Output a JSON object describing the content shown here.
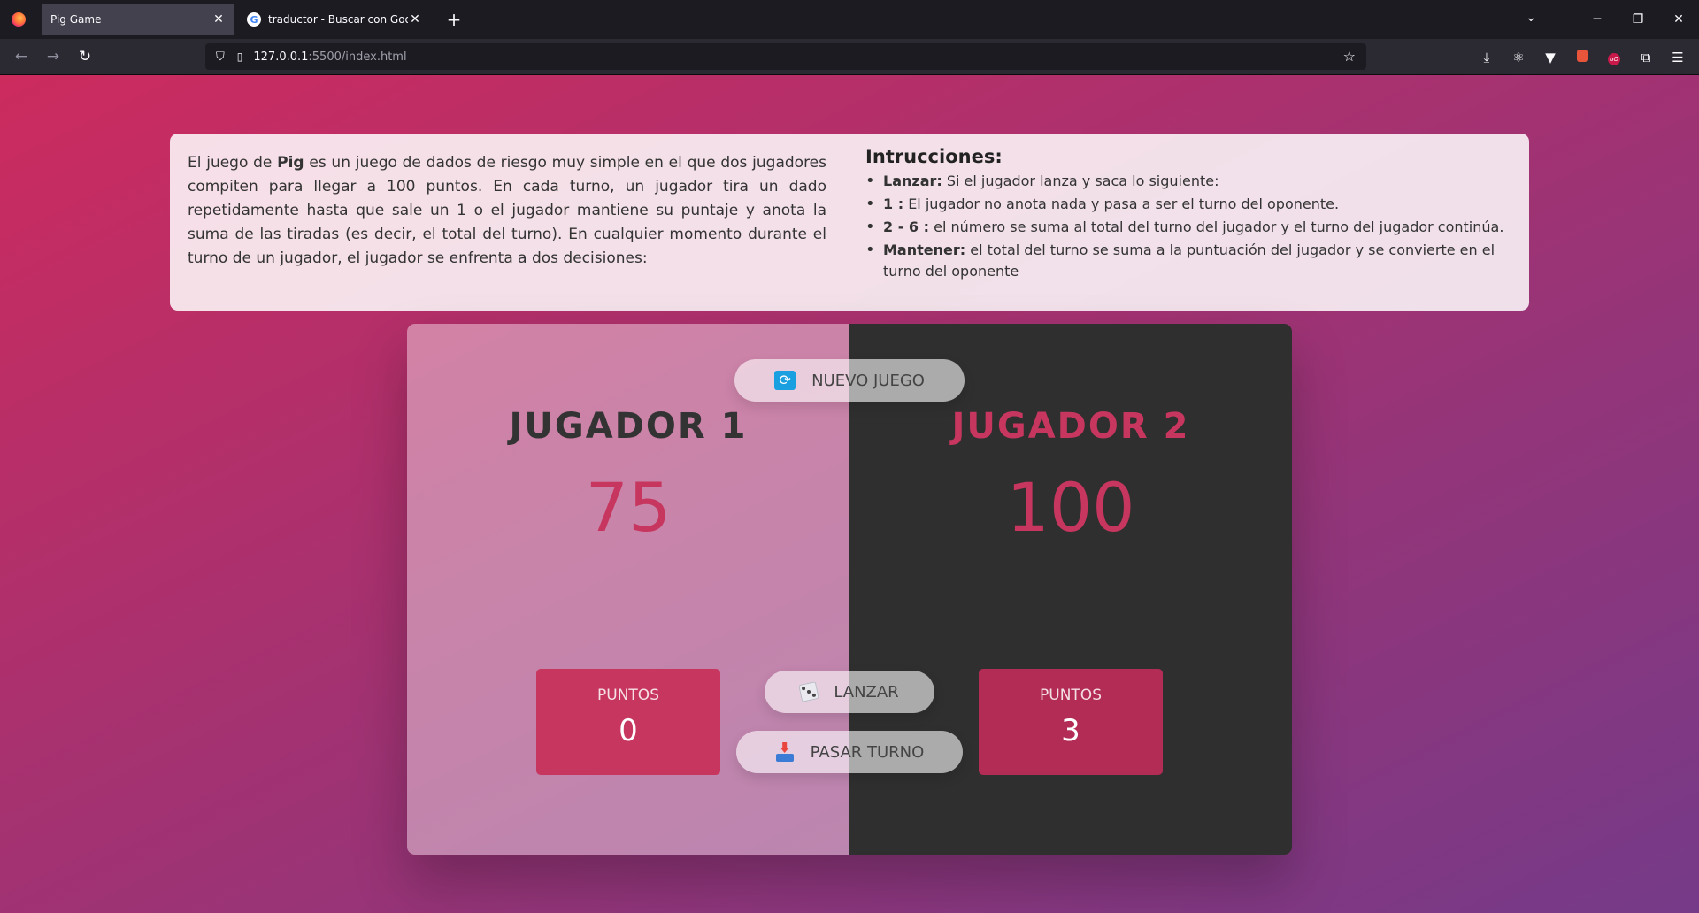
{
  "browser": {
    "tabs": [
      {
        "title": "Pig Game",
        "active": true
      },
      {
        "title": "traductor - Buscar con Google",
        "active": false
      }
    ],
    "url_host": "127.0.0.1",
    "url_path": ":5500/index.html"
  },
  "info": {
    "intro_before": "El juego de ",
    "intro_bold": "Pig",
    "intro_after": " es un juego de dados de riesgo muy simple en el que dos jugadores compiten para llegar a 100 puntos. En cada turno, un jugador tira un dado repetidamente hasta que sale un 1 o el jugador mantiene su puntaje y anota la suma de las tiradas (es decir, el total del turno). En cualquier momento durante el turno de un jugador, el jugador se enfrenta a dos decisiones:",
    "instructions_title": "Intrucciones:",
    "rules": [
      {
        "term": "Lanzar:",
        "text": " Si el jugador lanza y saca lo siguiente:"
      },
      {
        "term": "1 :",
        "text": " El jugador no anota nada y pasa a ser el turno del oponente."
      },
      {
        "term": "2 - 6 :",
        "text": " el número se suma al total del turno del jugador y el turno del jugador continúa."
      },
      {
        "term": "Mantener:",
        "text": " el total del turno se suma a la puntuación del jugador y se convierte en el turno del oponente"
      }
    ]
  },
  "game": {
    "new_game_label": "NUEVO JUEGO",
    "roll_label": "LANZAR",
    "hold_label": "PASAR TURNO",
    "players": [
      {
        "name": "JUGADOR 1",
        "score": "75",
        "current_label": "PUNTOS",
        "current_score": "0",
        "active": true
      },
      {
        "name": "JUGADOR 2",
        "score": "100",
        "current_label": "PUNTOS",
        "current_score": "3",
        "active": false
      }
    ]
  },
  "colors": {
    "accent": "#c7365f",
    "gradient_start": "#cc2b5e",
    "gradient_end": "#753a88"
  }
}
